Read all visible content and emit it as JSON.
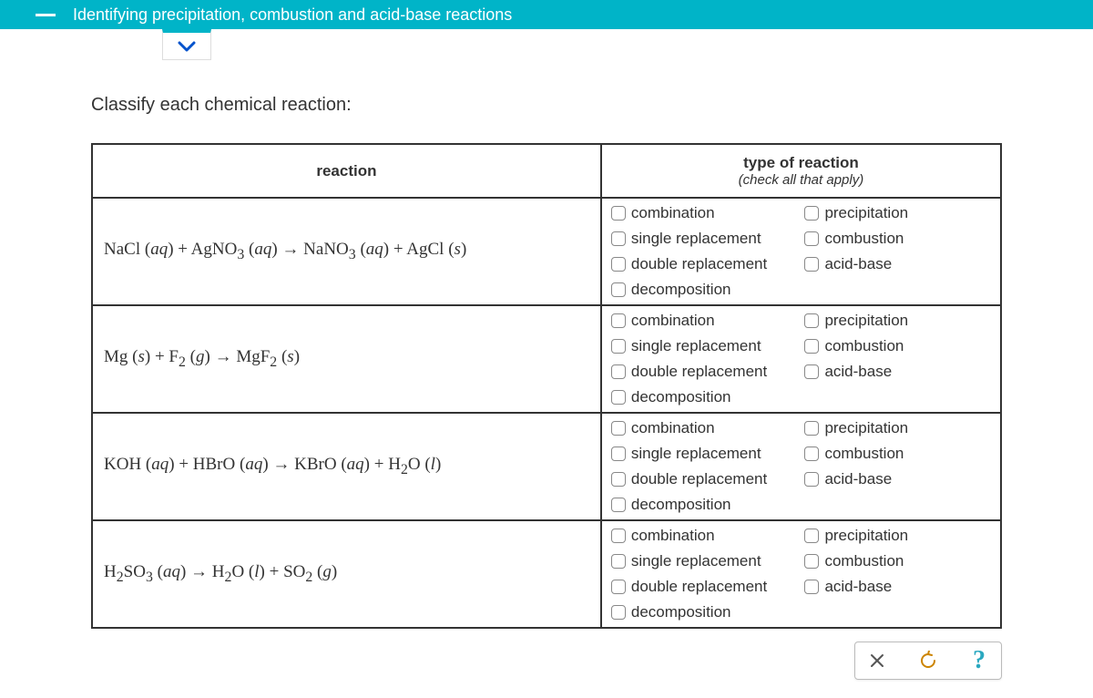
{
  "header": {
    "title": "Identifying precipitation, combustion and acid-base reactions"
  },
  "prompt": "Classify each chemical reaction:",
  "table": {
    "col1": "reaction",
    "col2": "type of reaction",
    "col2_sub": "(check all that apply)"
  },
  "reactions": [
    {
      "html": "NaCl (<i>aq</i>) + AgNO<sub>3</sub> (<i>aq</i>) → NaNO<sub>3</sub> (<i>aq</i>) + AgCl (<i>s</i>)"
    },
    {
      "html": "Mg (<i>s</i>) + F<sub>2</sub> (<i>g</i>) → MgF<sub>2</sub> (<i>s</i>)"
    },
    {
      "html": "KOH (<i>aq</i>) + HBrO (<i>aq</i>) → KBrO (<i>aq</i>) + H<sub>2</sub>O (<i>l</i>)"
    },
    {
      "html": "H<sub>2</sub>SO<sub>3</sub> (<i>aq</i>) → H<sub>2</sub>O (<i>l</i>) + SO<sub>2</sub> (<i>g</i>)"
    }
  ],
  "options": {
    "left": [
      "combination",
      "single replacement",
      "double replacement",
      "decomposition"
    ],
    "right": [
      "precipitation",
      "combustion",
      "acid-base"
    ]
  },
  "actions": {
    "close": "×",
    "reset": "↺",
    "help": "?"
  }
}
